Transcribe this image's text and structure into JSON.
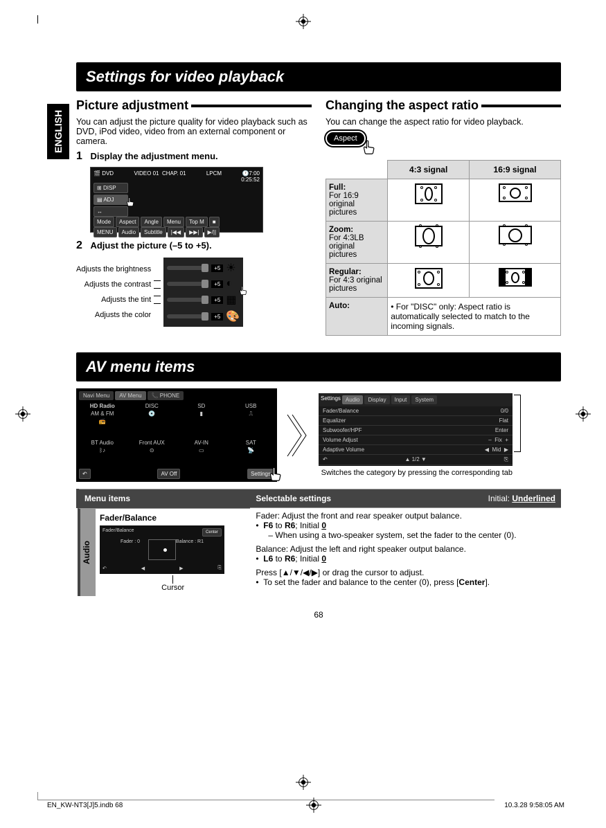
{
  "lang_tab": "ENGLISH",
  "title1": "Settings for video playback",
  "left": {
    "heading": "Picture adjustment",
    "intro": "You can adjust the picture quality for video playback such as DVD, iPod video, video from an external component or camera.",
    "step1_num": "1",
    "step1_text": "Display the adjustment menu.",
    "dvd_shot": {
      "dvd": "DVD",
      "video": "VIDEO",
      "title_n": "01",
      "chap": "CHAP.",
      "chap_n": "01",
      "lpcm": "LPCM",
      "time": "0:25:52",
      "clock": "7:00",
      "disp": "DISP",
      "adj": "ADJ",
      "row1": [
        "Mode",
        "Aspect",
        "Angle",
        "Menu",
        "Top M"
      ],
      "row2": [
        "MENU",
        "Audio",
        "Subtitle"
      ]
    },
    "step2_num": "2",
    "step2_text": "Adjust the picture (–5 to +5).",
    "adj_labels": {
      "bright": "Adjusts the brightness",
      "contrast": "Adjusts the contrast",
      "tint": "Adjusts the tint",
      "color": "Adjusts the color"
    },
    "adj_val": "+5"
  },
  "right": {
    "heading": "Changing the aspect ratio",
    "intro": "You can change the aspect ratio for video playback.",
    "aspect_btn": "Aspect",
    "table": {
      "h1": "4:3 signal",
      "h2": "16:9 signal",
      "full_t": "Full:",
      "full_d": "For 16:9 original pictures",
      "zoom_t": "Zoom:",
      "zoom_d": "For 4:3LB original pictures",
      "reg_t": "Regular:",
      "reg_d": "For 4:3 original pictures",
      "auto_t": "Auto:",
      "auto_d": "For \"DISC\" only: Aspect ratio is automatically selected to match to the incoming signals."
    }
  },
  "title2": "AV menu items",
  "av_shot": {
    "tabs": [
      "Navi Menu",
      "AV Menu",
      "PHONE"
    ],
    "hd": "HD Radio",
    "sub": "AM & FM",
    "sources": [
      "DISC",
      "SD",
      "USB",
      "BT Audio",
      "Front AUX",
      "AV-IN",
      "SAT"
    ],
    "avoff": "AV Off",
    "settings": "Settings"
  },
  "settings_shot": {
    "title": "Settings",
    "tabs": [
      "Audio",
      "Display",
      "Input",
      "System"
    ],
    "rows": [
      [
        "Fader/Balance",
        "0/0"
      ],
      [
        "Equalizer",
        "Flat"
      ],
      [
        "Subwoofer/HPF",
        "Enter"
      ],
      [
        "Volume Adjust",
        "Fix"
      ],
      [
        "Adaptive Volume",
        "Mid"
      ]
    ],
    "page": "1/2"
  },
  "settings_caption": "Switches the category by pressing the corresponding tab",
  "menu_table": {
    "col1": "Menu items",
    "col2": "Selectable settings",
    "col2_right": "Initial: ",
    "col2_right_u": "Underlined",
    "audio_tab": "Audio",
    "item1": "Fader/Balance",
    "fb_top": "Fader/Balance",
    "fb_center": "Center",
    "fb_fader": "Fader : 0",
    "fb_bal": "Balance : R1",
    "cursor": "Cursor",
    "d1": "Fader: Adjust the front and rear speaker output balance.",
    "d2a": "F6",
    "d2b": " to ",
    "d2c": "R6",
    "d2d": "; Initial ",
    "d2e": "0",
    "d3": "– When using a two-speaker system, set the fader to the center (0).",
    "d4": "Balance: Adjust the left and right speaker output balance.",
    "d5a": "L6",
    "d5b": " to ",
    "d5c": "R6",
    "d5d": "; Initial ",
    "d5e": "0",
    "d6": "Press [▲/▼/◀/▶] or drag the cursor to adjust.",
    "d7a": "To set the fader and balance to the center (0), press [",
    "d7b": "Center",
    "d7c": "]."
  },
  "page_num": "68",
  "footer_left": "EN_KW-NT3[J]5.indb   68",
  "footer_right": "10.3.28   9:58:05 AM"
}
